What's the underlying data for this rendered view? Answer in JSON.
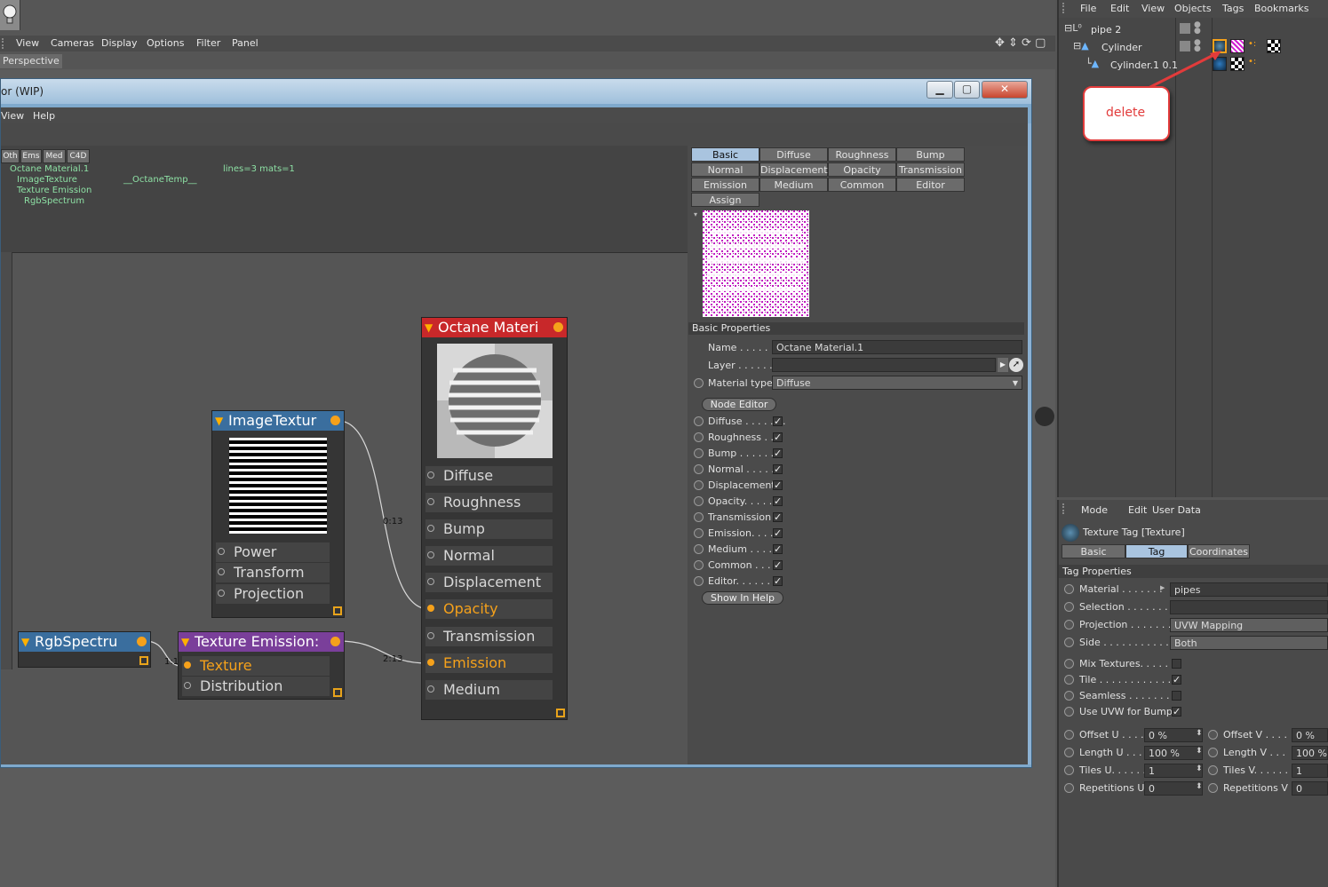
{
  "viewport": {
    "menu": [
      "View",
      "Cameras",
      "Display",
      "Options",
      "Filter",
      "Panel"
    ],
    "label": "Perspective"
  },
  "node_editor": {
    "title": "or (WIP)",
    "menu": [
      "View",
      "Help"
    ],
    "filter_tabs": [
      "Oth",
      "Ems",
      "Med",
      "C4D"
    ],
    "graph_text": {
      "col1": [
        "Octane Material.1",
        "ImageTexture",
        "Texture Emission",
        "RgbSpectrum"
      ],
      "temp": "__OctaneTemp__",
      "stats": "lines=3 mats=1"
    },
    "nodes": {
      "material": {
        "title": "Octane Materi",
        "pins": [
          "Diffuse",
          "Roughness",
          "Bump",
          "Normal",
          "Displacement",
          "Opacity",
          "Transmission",
          "Emission",
          "Medium"
        ],
        "active": [
          "Opacity",
          "Emission"
        ]
      },
      "image_texture": {
        "title": "ImageTextur",
        "pins": [
          "Power",
          "Transform",
          "Projection"
        ]
      },
      "texture_emission": {
        "title": "Texture Emission:",
        "pins": [
          "Texture",
          "Distribution"
        ],
        "active": [
          "Texture"
        ]
      },
      "rgb_spectrum": {
        "title": "RgbSpectru"
      }
    },
    "wire_labels": [
      "0:13",
      "1:13",
      "2:13"
    ],
    "prop_tabs": [
      "Basic",
      "Diffuse",
      "Roughness",
      "Bump",
      "Normal",
      "Displacement",
      "Opacity",
      "Transmission",
      "Emission",
      "Medium",
      "Common",
      "Editor",
      "Assign"
    ],
    "active_tab": "Basic",
    "basic_properties": {
      "header": "Basic Properties",
      "name_label": "Name . . . . . .",
      "name_value": "Octane Material.1",
      "layer_label": "Layer . . . . . . .",
      "layer_value": "",
      "material_type_label": "Material type",
      "material_type_value": "Diffuse",
      "node_editor_button": "Node Editor",
      "channels": [
        {
          "label": "Diffuse . . . . . . .",
          "checked": true
        },
        {
          "label": "Roughness . . .",
          "checked": true
        },
        {
          "label": "Bump . . . . . . .",
          "checked": true
        },
        {
          "label": "Normal . . . . . .",
          "checked": true
        },
        {
          "label": "Displacement",
          "checked": true
        },
        {
          "label": "Opacity. . . . . .",
          "checked": true
        },
        {
          "label": "Transmission",
          "checked": true
        },
        {
          "label": "Emission. . . . .",
          "checked": true
        },
        {
          "label": "Medium . . . . .",
          "checked": true
        },
        {
          "label": "Common . . . .",
          "checked": true
        },
        {
          "label": "Editor. . . . . . .",
          "checked": true
        }
      ],
      "help_button": "Show In Help"
    }
  },
  "object_manager": {
    "menu": [
      "File",
      "Edit",
      "View",
      "Objects",
      "Tags",
      "Bookmarks"
    ],
    "tree": [
      {
        "label": "pipe 2",
        "depth": 0
      },
      {
        "label": "Cylinder",
        "depth": 1
      },
      {
        "label": "Cylinder.1 0.1",
        "depth": 2
      }
    ]
  },
  "annotation": {
    "text": "delete",
    "color": "#e23b3b"
  },
  "attribute_manager": {
    "menu": [
      "Mode",
      "Edit",
      "User Data"
    ],
    "title": "Texture Tag [Texture]",
    "tabs": [
      "Basic",
      "Tag",
      "Coordinates"
    ],
    "active_tab": "Tag",
    "section": "Tag Properties",
    "rows1": [
      {
        "label": "Material . . . . . . .",
        "value": "pipes"
      },
      {
        "label": "Selection . . . . . . . .",
        "value": ""
      },
      {
        "label": "Projection . . . . . . .",
        "value": "UVW Mapping"
      },
      {
        "label": "Side . . . . . . . . . . . .",
        "value": "Both"
      }
    ],
    "checks": [
      {
        "label": "Mix Textures. . . . .",
        "checked": false
      },
      {
        "label": "Tile . . . . . . . . . . . . .",
        "checked": true
      },
      {
        "label": "Seamless . . . . . . . .",
        "checked": false
      },
      {
        "label": "Use UVW for Bump",
        "checked": true
      }
    ],
    "fields": [
      {
        "left_label": "Offset U . . . .",
        "left_value": "0 %",
        "right_label": "Offset V . . . .",
        "right_value": "0 %"
      },
      {
        "left_label": "Length U . . .",
        "left_value": "100 %",
        "right_label": "Length V . . .",
        "right_value": "100 %"
      },
      {
        "left_label": "Tiles U. . . . . .",
        "left_value": "1",
        "right_label": "Tiles V. . . . . .",
        "right_value": "1"
      },
      {
        "left_label": "Repetitions U",
        "left_value": "0",
        "right_label": "Repetitions V",
        "right_value": "0"
      }
    ]
  },
  "colors": {
    "accent": "#f5a11b",
    "material_head": "#c8282a",
    "texture_head": "#3a6e9e",
    "emission_head": "#7a3f9a",
    "active_tab": "#a9c4df"
  }
}
